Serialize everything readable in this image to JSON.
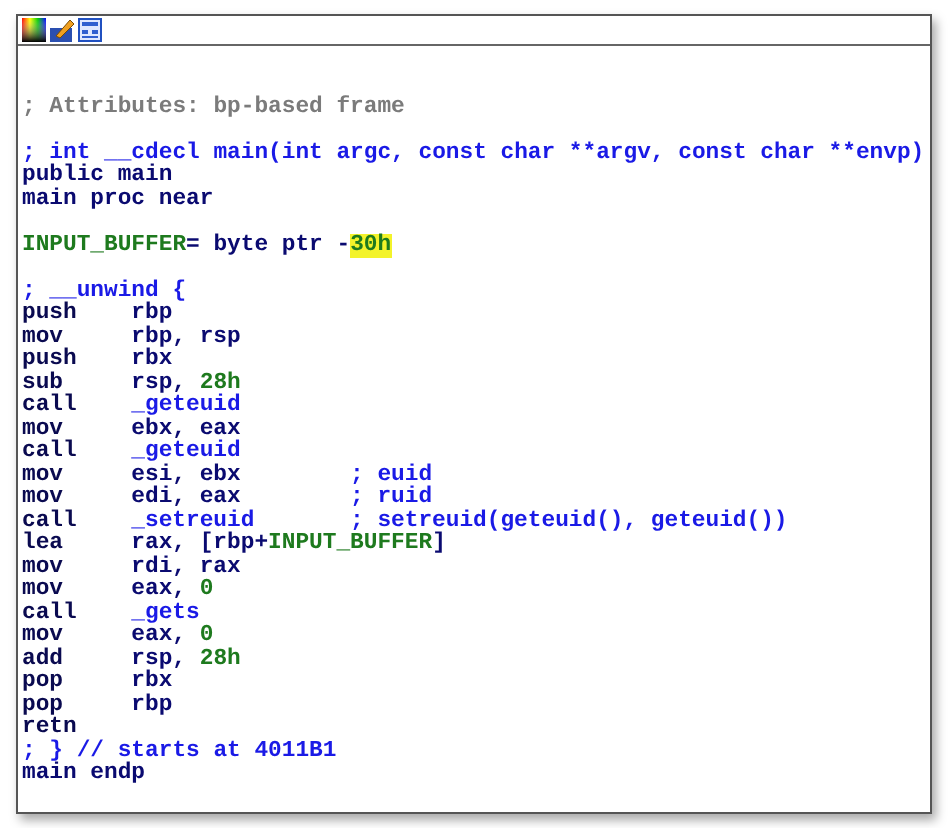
{
  "toolbar": {
    "buttons": [
      {
        "kind": "palette"
      },
      {
        "kind": "edit"
      },
      {
        "kind": "graph"
      }
    ]
  },
  "lines": [
    {
      "kind": "blank"
    },
    {
      "kind": "note",
      "text": "; Attributes: bp-based frame"
    },
    {
      "kind": "blank"
    },
    {
      "kind": "comment",
      "text": "; int __cdecl main(int argc, const char **argv, const char **envp)"
    },
    {
      "kind": "directive",
      "text": "public main"
    },
    {
      "kind": "directive",
      "text": "main proc near"
    },
    {
      "kind": "blank"
    },
    {
      "kind": "var",
      "name": "INPUT_BUFFER",
      "def": "= byte ptr -",
      "value": "30h",
      "highlighted": true
    },
    {
      "kind": "blank"
    },
    {
      "kind": "comment",
      "text": "; __unwind {"
    },
    {
      "kind": "instr",
      "mnemonic": "push",
      "operands": [
        {
          "text": "rbp",
          "kind": "reg"
        }
      ]
    },
    {
      "kind": "instr",
      "mnemonic": "mov",
      "operands": [
        {
          "text": "rbp, rsp",
          "kind": "reg"
        }
      ]
    },
    {
      "kind": "instr",
      "mnemonic": "push",
      "operands": [
        {
          "text": "rbx",
          "kind": "reg"
        }
      ]
    },
    {
      "kind": "instr",
      "mnemonic": "sub",
      "operands": [
        {
          "text": "rsp, ",
          "kind": "reg"
        },
        {
          "text": "28h",
          "kind": "num"
        }
      ]
    },
    {
      "kind": "instr",
      "mnemonic": "call",
      "operands": [
        {
          "text": "_geteuid",
          "kind": "func"
        }
      ]
    },
    {
      "kind": "instr",
      "mnemonic": "mov",
      "operands": [
        {
          "text": "ebx, eax",
          "kind": "reg"
        }
      ]
    },
    {
      "kind": "instr",
      "mnemonic": "call",
      "operands": [
        {
          "text": "_geteuid",
          "kind": "func"
        }
      ]
    },
    {
      "kind": "instr",
      "mnemonic": "mov",
      "operands": [
        {
          "text": "esi, ebx",
          "kind": "reg"
        }
      ],
      "comment": "; euid"
    },
    {
      "kind": "instr",
      "mnemonic": "mov",
      "operands": [
        {
          "text": "edi, eax",
          "kind": "reg"
        }
      ],
      "comment": "; ruid"
    },
    {
      "kind": "instr",
      "mnemonic": "call",
      "operands": [
        {
          "text": "_setreuid",
          "kind": "func"
        }
      ],
      "comment": "; setreuid(geteuid(), geteuid())"
    },
    {
      "kind": "instr",
      "mnemonic": "lea",
      "operands": [
        {
          "text": "rax, [rbp+",
          "kind": "reg"
        },
        {
          "text": "INPUT_BUFFER",
          "kind": "name"
        },
        {
          "text": "]",
          "kind": "reg"
        }
      ]
    },
    {
      "kind": "instr",
      "mnemonic": "mov",
      "operands": [
        {
          "text": "rdi, rax",
          "kind": "reg"
        }
      ]
    },
    {
      "kind": "instr",
      "mnemonic": "mov",
      "operands": [
        {
          "text": "eax, ",
          "kind": "reg"
        },
        {
          "text": "0",
          "kind": "num"
        }
      ]
    },
    {
      "kind": "instr",
      "mnemonic": "call",
      "operands": [
        {
          "text": "_gets",
          "kind": "func"
        }
      ]
    },
    {
      "kind": "instr",
      "mnemonic": "mov",
      "operands": [
        {
          "text": "eax, ",
          "kind": "reg"
        },
        {
          "text": "0",
          "kind": "num"
        }
      ]
    },
    {
      "kind": "instr",
      "mnemonic": "add",
      "operands": [
        {
          "text": "rsp, ",
          "kind": "reg"
        },
        {
          "text": "28h",
          "kind": "num"
        }
      ]
    },
    {
      "kind": "instr",
      "mnemonic": "pop",
      "operands": [
        {
          "text": "rbx",
          "kind": "reg"
        }
      ]
    },
    {
      "kind": "instr",
      "mnemonic": "pop",
      "operands": [
        {
          "text": "rbp",
          "kind": "reg"
        }
      ]
    },
    {
      "kind": "instr",
      "mnemonic": "retn"
    },
    {
      "kind": "comment",
      "text": "; } // starts at 4011B1"
    },
    {
      "kind": "directive",
      "text": "main endp"
    }
  ]
}
